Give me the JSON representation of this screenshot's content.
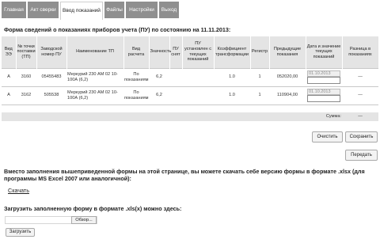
{
  "tabs": [
    {
      "label": "Главная"
    },
    {
      "label": "Акт сверки"
    },
    {
      "label": "Ввод показаний"
    },
    {
      "label": "Файлы"
    },
    {
      "label": "Настройки"
    },
    {
      "label": "Выход"
    }
  ],
  "heading": "Форма сведений о показаниях приборов учета (ПУ) по состоянию на 11.11.2013:",
  "table": {
    "columns": [
      "Вид ЭЭ",
      "№ точки поставки (ТП)",
      "Заводской номер ПУ",
      "Наименование ТП",
      "Вид расчета",
      "Значность",
      "ПУ снят",
      "ПУ установлен с текущих показаний",
      "Коэффициент трансформации",
      "Регистр",
      "Предыдущие показания",
      "Дата и значение текущих показаний",
      "Разница в показаниях"
    ],
    "rows": [
      {
        "vid": "А",
        "tp_no": "3160",
        "serial": "05455483",
        "name": "Меркурий 230 АМ 02 10-100А (6,2)",
        "calc": "По показаниям",
        "digits": "6,2",
        "removed": "",
        "installed": "",
        "coef": "1.0",
        "register": "1",
        "prev": "052020,00",
        "date": "01.10.2013",
        "diff": "—"
      },
      {
        "vid": "А",
        "tp_no": "3162",
        "serial": "505538",
        "name": "Меркурий 230 АМ 02 10-100А (6,2)",
        "calc": "По показаниям",
        "digits": "6,2",
        "removed": "",
        "installed": "",
        "coef": "1.0",
        "register": "1",
        "prev": "110904,00",
        "date": "01.10.2013",
        "diff": "—"
      }
    ],
    "sum_label": "Сумма:",
    "sum_value": "—"
  },
  "buttons": {
    "clear": "Очистить",
    "save": "Сохранить",
    "submit": "Передать",
    "upload": "Загрузить"
  },
  "excel_text": "Вместо заполнения вышеприведенной формы на этой странице, вы можете скачать себе версию формы в формате .xlsx (для программы MS Excel 2007 или аналогичной):",
  "download_link": "Скачать",
  "upload_label": "Загрузить заполненную форму в формате .xls(x) можно здесь:",
  "browse_label": "Обзор..."
}
